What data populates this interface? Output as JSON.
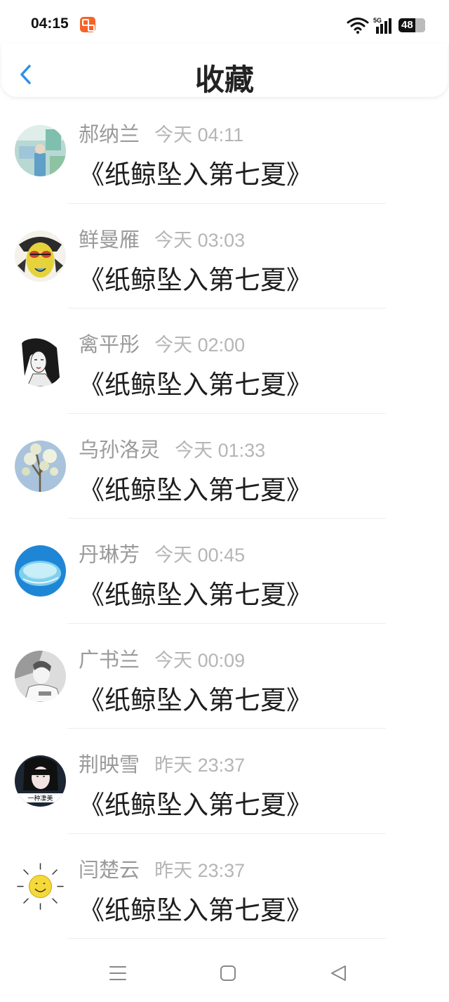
{
  "status_bar": {
    "time": "04:15",
    "network": "5G",
    "battery": "48"
  },
  "header": {
    "title": "收藏"
  },
  "items": [
    {
      "name": "郝纳兰",
      "time": "今天 04:11",
      "content": "《纸鲸坠入第七夏》",
      "avatar": "illustration-avatar"
    },
    {
      "name": "鲜曼雁",
      "time": "今天 03:03",
      "content": "《纸鲸坠入第七夏》",
      "avatar": "cartoon-face-avatar"
    },
    {
      "name": "禽平彤",
      "time": "今天 02:00",
      "content": "《纸鲸坠入第七夏》",
      "avatar": "sketch-girl-avatar"
    },
    {
      "name": "乌孙洛灵",
      "time": "今天 01:33",
      "content": "《纸鲸坠入第七夏》",
      "avatar": "blossom-tree-avatar"
    },
    {
      "name": "丹琳芳",
      "time": "今天 00:45",
      "content": "《纸鲸坠入第七夏》",
      "avatar": "jellyfish-avatar"
    },
    {
      "name": "广书兰",
      "time": "今天 00:09",
      "content": "《纸鲸坠入第七夏》",
      "avatar": "grayscale-photo-avatar"
    },
    {
      "name": "荆映雪",
      "time": "昨天 23:37",
      "content": "《纸鲸坠入第七夏》",
      "avatar": "girl-photo-avatar",
      "avatar_caption": "一种凄美"
    },
    {
      "name": "闫楚云",
      "time": "昨天 23:37",
      "content": "《纸鲸坠入第七夏》",
      "avatar": "sun-doodle-avatar"
    }
  ],
  "colors": {
    "accent": "#2f8fe6",
    "name": "#9a9a9a",
    "time": "#b5b5b5",
    "content": "#1e1e1e"
  },
  "navbar": {
    "icons": [
      "menu-icon",
      "home-square-icon",
      "back-triangle-icon"
    ]
  }
}
